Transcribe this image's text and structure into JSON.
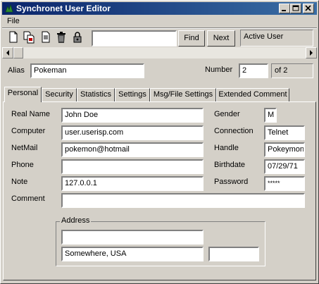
{
  "window": {
    "title": "Synchronet User Editor"
  },
  "menu": {
    "file": "File"
  },
  "toolbar": {
    "icons": [
      "new-file-icon",
      "copy-file-icon",
      "page-icon",
      "trash-icon",
      "lock-icon"
    ],
    "search_value": "",
    "find_label": "Find",
    "next_label": "Next",
    "status": "Active User"
  },
  "user": {
    "alias_label": "Alias",
    "alias": "Pokeman",
    "number_label": "Number",
    "number": "2",
    "of_text": "of 2"
  },
  "tabs": [
    "Personal",
    "Security",
    "Statistics",
    "Settings",
    "Msg/File Settings",
    "Extended Comment"
  ],
  "personal": {
    "real_name_label": "Real Name",
    "real_name": "John Doe",
    "computer_label": "Computer",
    "computer": "user.userisp.com",
    "netmail_label": "NetMail",
    "netmail": "pokemon@hotmail",
    "phone_label": "Phone",
    "phone": "",
    "note_label": "Note",
    "note": "127.0.0.1",
    "comment_label": "Comment",
    "comment": "",
    "gender_label": "Gender",
    "gender": "M",
    "connection_label": "Connection",
    "connection": "Telnet",
    "handle_label": "Handle",
    "handle": "Pokeymon",
    "birthdate_label": "Birthdate",
    "birthdate": "07/29/71",
    "password_label": "Password",
    "password": "*****"
  },
  "address": {
    "group_label": "Address",
    "line1": "",
    "city": "Somewhere, USA",
    "zip": ""
  }
}
